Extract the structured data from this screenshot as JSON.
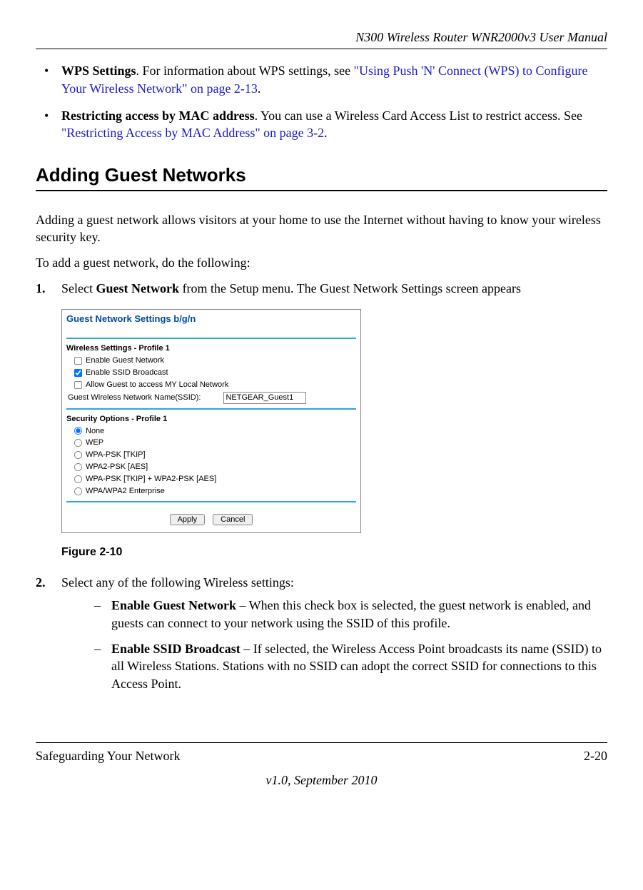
{
  "header": {
    "manual_title": "N300 Wireless Router WNR2000v3 User Manual"
  },
  "bullets": [
    {
      "bold": "WPS Settings",
      "text_before_link": ". For information about WPS settings, see ",
      "link": "\"Using Push 'N' Connect (WPS) to Configure Your Wireless Network\" on page 2-13",
      "text_after_link": "."
    },
    {
      "bold": "Restricting access by MAC address",
      "text_before_link": ". You can use a Wireless Card Access List to restrict access. See ",
      "link": "\"Restricting Access by MAC Address\" on page 3-2",
      "text_after_link": "."
    }
  ],
  "section_heading": "Adding Guest Networks",
  "intro1": "Adding a guest network allows visitors at your home to use the Internet without having to know your wireless security key.",
  "intro2": "To add a guest network, do the following:",
  "step1": {
    "num": "1.",
    "text_before_bold": "Select ",
    "bold": "Guest Network",
    "text_after_bold": " from the Setup menu. The Guest Network Settings screen appears"
  },
  "screenshot": {
    "title": "Guest Network Settings b/g/n",
    "wireless_label": "Wireless Settings - Profile 1",
    "cb_enable_guest": "Enable Guest Network",
    "cb_enable_ssid": "Enable SSID Broadcast",
    "cb_allow_guest": "Allow Guest to access MY Local Network",
    "ssid_label": "Guest Wireless Network Name(SSID):",
    "ssid_value": "NETGEAR_Guest1",
    "security_label": "Security Options - Profile 1",
    "radios": [
      "None",
      "WEP",
      "WPA-PSK [TKIP]",
      "WPA2-PSK [AES]",
      "WPA-PSK [TKIP] + WPA2-PSK [AES]",
      "WPA/WPA2 Enterprise"
    ],
    "apply": "Apply",
    "cancel": "Cancel"
  },
  "figure_caption": "Figure 2-10",
  "step2": {
    "num": "2.",
    "text": "Select any of the following Wireless settings:"
  },
  "sub_items": [
    {
      "bold": "Enable Guest Network",
      "rest": " – When this check box is selected, the guest network is enabled, and guests can connect to your network using the SSID of this profile."
    },
    {
      "bold": "Enable SSID Broadcast",
      "rest": " – If selected, the Wireless Access Point broadcasts its name (SSID) to all Wireless Stations. Stations with no SSID can adopt the correct SSID for connections to this Access Point."
    }
  ],
  "footer": {
    "left": "Safeguarding Your Network",
    "right": "2-20",
    "center": "v1.0, September 2010"
  }
}
